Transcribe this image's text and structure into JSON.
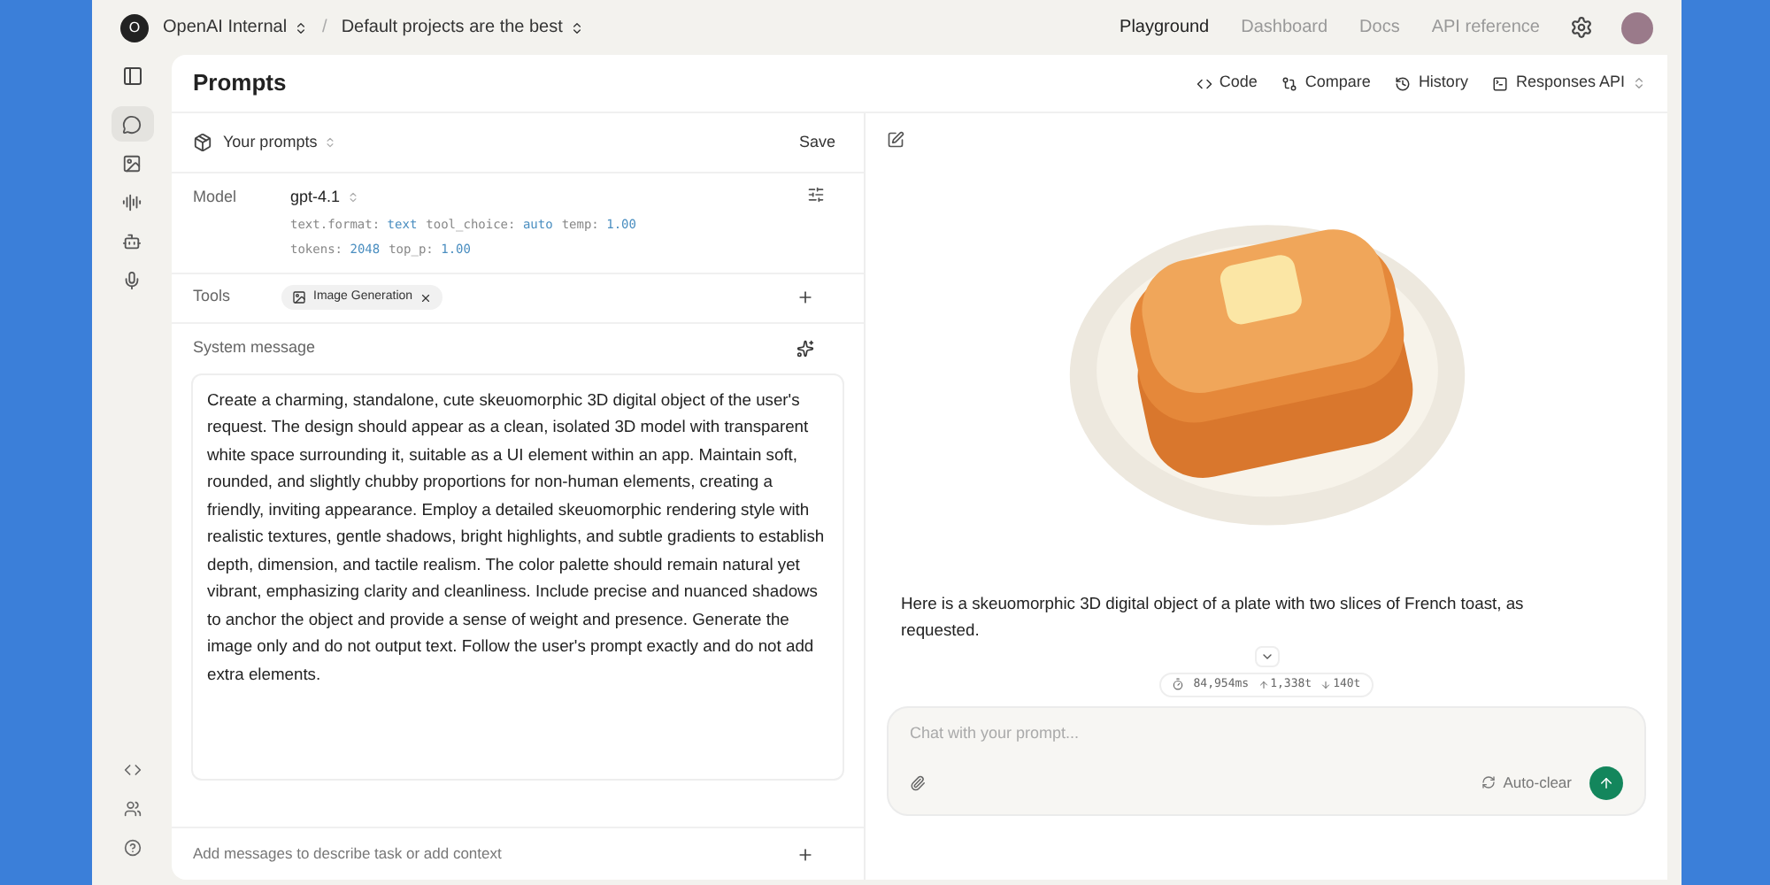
{
  "topbar": {
    "org_initial": "O",
    "org": "OpenAI Internal",
    "separator": "/",
    "project": "Default projects are the best",
    "nav": [
      {
        "label": "Playground",
        "selected": true
      },
      {
        "label": "Dashboard",
        "selected": false
      },
      {
        "label": "Docs",
        "selected": false
      },
      {
        "label": "API reference",
        "selected": false
      }
    ]
  },
  "sidebar": {
    "items": [
      {
        "kind": "chat",
        "selected": true
      },
      {
        "kind": "image",
        "selected": false
      },
      {
        "kind": "audio",
        "selected": false
      },
      {
        "kind": "assistant",
        "selected": false
      },
      {
        "kind": "mic",
        "selected": false
      }
    ],
    "bottom": [
      {
        "kind": "code"
      },
      {
        "kind": "people"
      },
      {
        "kind": "help"
      }
    ]
  },
  "header": {
    "title": "Prompts",
    "actions": [
      {
        "kind": "code",
        "label": "Code"
      },
      {
        "kind": "compare",
        "label": "Compare"
      },
      {
        "kind": "history",
        "label": "History"
      },
      {
        "kind": "api",
        "label": "Responses API"
      }
    ]
  },
  "prompt": {
    "selector": "Your prompts",
    "save": "Save",
    "model_label": "Model",
    "model": "gpt-4.1",
    "params": [
      {
        "key": "text.format:",
        "value": "text"
      },
      {
        "key": "tool_choice:",
        "value": "auto"
      },
      {
        "key": "temp:",
        "value": "1.00"
      },
      {
        "key": "tokens:",
        "value": "2048"
      },
      {
        "key": "top_p:",
        "value": "1.00"
      }
    ],
    "tools_label": "Tools",
    "tools": [
      "Image Generation"
    ],
    "system_label": "System message",
    "system_message": "Create a charming, standalone, cute skeuomorphic 3D digital object of the user's request. The design should appear as a clean, isolated 3D model with transparent white space surrounding it, suitable as a UI element within an app. Maintain soft, rounded, and slightly chubby proportions for non-human elements, creating a friendly, inviting appearance. Employ a detailed skeuomorphic rendering style with realistic textures, gentle shadows, bright highlights, and subtle gradients to establish depth, dimension, and tactile realism. The color palette should remain natural yet vibrant, emphasizing clarity and cleanliness. Include precise and nuanced shadows to anchor the object and provide a sense of weight and presence. Generate the image only and do not output text. Follow the user's prompt exactly and do not add extra elements.",
    "add_messages": "Add messages to describe task or add context"
  },
  "response": {
    "text": "Here is a skeuomorphic 3D digital object of a plate with two slices of French toast, as requested.",
    "stats": {
      "time": "84,954ms",
      "input": "1,338t",
      "output": "140t"
    }
  },
  "chat": {
    "placeholder": "Chat with your prompt...",
    "auto_clear": "Auto-clear"
  }
}
